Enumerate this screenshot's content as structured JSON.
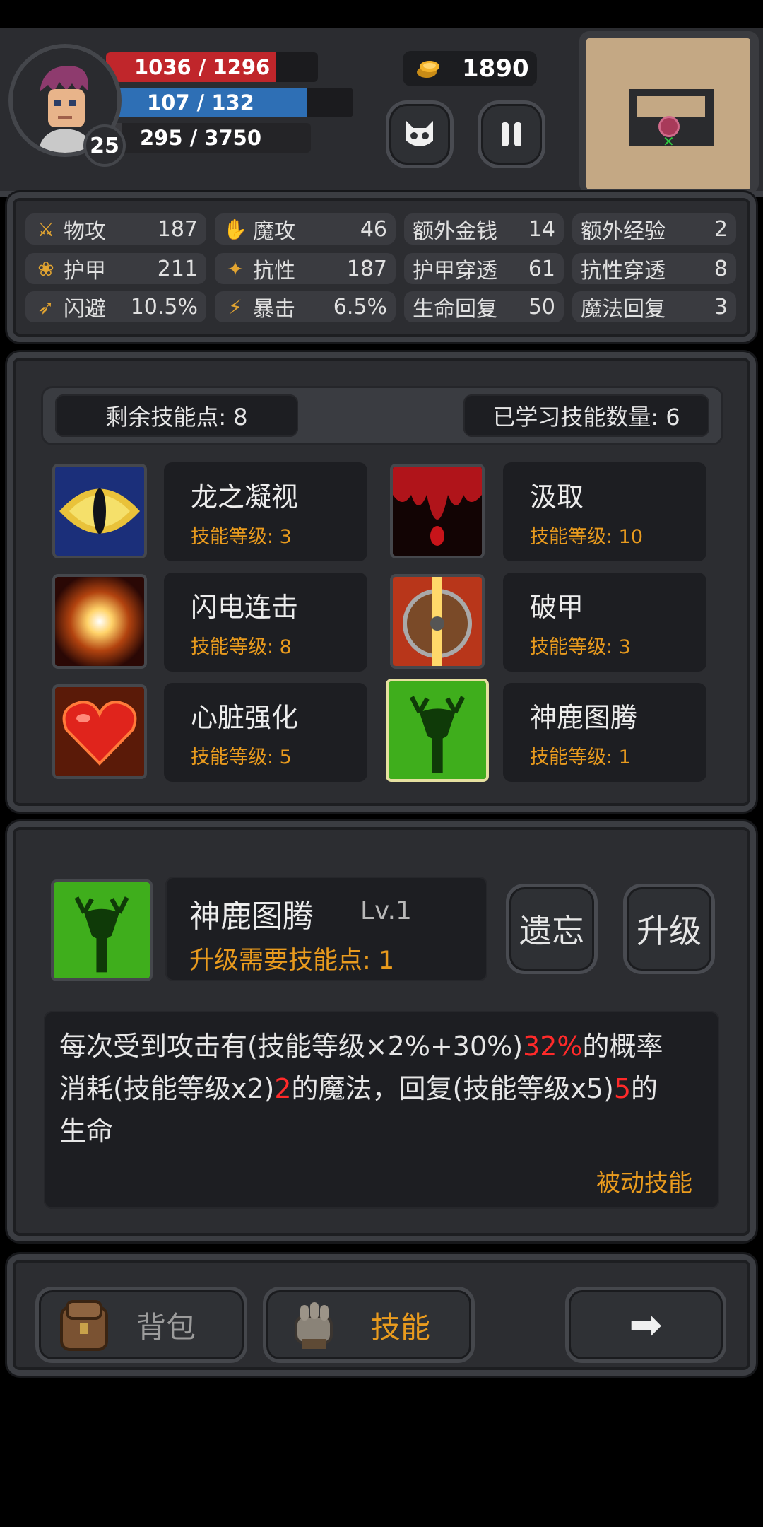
{
  "player": {
    "level": "25",
    "hp": "1036 / 1296",
    "hp_fraction": 0.8,
    "mp": "107 / 132",
    "mp_fraction": 0.81,
    "xp": "295 / 3750",
    "xp_fraction": 0.08,
    "gold": "1890"
  },
  "colors": {
    "hp": "#c0262b",
    "mp": "#2e6fb5",
    "accent": "#e99b1e",
    "highlight": "#ff2a2a"
  },
  "stats": [
    {
      "icon": "sword-icon",
      "label": "物攻",
      "value": "187"
    },
    {
      "icon": "magic-icon",
      "label": "魔攻",
      "value": "46"
    },
    {
      "icon": "",
      "label": "额外金钱",
      "value": "14"
    },
    {
      "icon": "",
      "label": "额外经验",
      "value": "2"
    },
    {
      "icon": "paw-icon",
      "label": "护甲",
      "value": "211"
    },
    {
      "icon": "muscle-icon",
      "label": "抗性",
      "value": "187"
    },
    {
      "icon": "",
      "label": "护甲穿透",
      "value": "61"
    },
    {
      "icon": "",
      "label": "抗性穿透",
      "value": "8"
    },
    {
      "icon": "run-icon",
      "label": "闪避",
      "value": "10.5%"
    },
    {
      "icon": "lightning-icon",
      "label": "暴击",
      "value": "6.5%"
    },
    {
      "icon": "",
      "label": "生命回复",
      "value": "50"
    },
    {
      "icon": "",
      "label": "魔法回复",
      "value": "3"
    }
  ],
  "skills_header": {
    "remaining": "剩余技能点: 8",
    "learned": "已学习技能数量: 6"
  },
  "skills": [
    {
      "name": "龙之凝视",
      "level": "技能等级: 3",
      "icon": "dragon-eye-icon"
    },
    {
      "name": "汲取",
      "level": "技能等级: 10",
      "icon": "blood-drip-icon"
    },
    {
      "name": "闪电连击",
      "level": "技能等级: 8",
      "icon": "flash-icon"
    },
    {
      "name": "破甲",
      "level": "技能等级: 3",
      "icon": "broken-shield-icon"
    },
    {
      "name": "心脏强化",
      "level": "技能等级: 5",
      "icon": "heart-icon"
    },
    {
      "name": "神鹿图腾",
      "level": "技能等级: 1",
      "icon": "deer-totem-icon"
    }
  ],
  "detail": {
    "name": "神鹿图腾",
    "lv": "Lv.1",
    "cost": "升级需要技能点: 1",
    "forget": "遗忘",
    "upgrade": "升级",
    "desc_1a": "每次受到攻击有(技能等级×2%+30%)",
    "desc_1b": "32%",
    "desc_1c": "的概率",
    "desc_2a": "消耗(技能等级x2)",
    "desc_2b": "2",
    "desc_2c": "的魔法，回复(技能等级x5)",
    "desc_2d": "5",
    "desc_2e": "的",
    "desc_3": "生命",
    "type": "被动技能"
  },
  "bottom": {
    "bag": "背包",
    "skills": "技能",
    "arrow": "➡"
  }
}
